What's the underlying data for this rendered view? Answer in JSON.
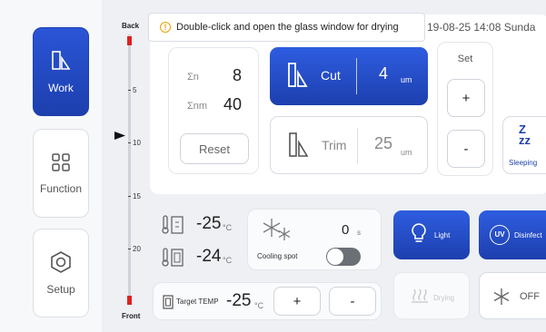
{
  "nav": {
    "work": "Work",
    "function": "Function",
    "setup": "Setup"
  },
  "ruler": {
    "top_label": "Back",
    "bottom_label": "Front",
    "ticks": [
      "5",
      "10",
      "15",
      "20"
    ]
  },
  "tooltip": {
    "text": "Double-click and open the glass window for drying"
  },
  "status": {
    "datetime": "19-08-25  14:08  Sunda"
  },
  "counters": {
    "sigma_n_label": "Σn",
    "sigma_n_value": "8",
    "sigma_nm_label": "Σnm",
    "sigma_nm_value": "40",
    "reset_label": "Reset"
  },
  "cut": {
    "label": "Cut",
    "value": "4",
    "unit": "um"
  },
  "trim": {
    "label": "Trim",
    "value": "25",
    "unit": "um"
  },
  "set": {
    "label": "Set",
    "plus": "+",
    "minus": "-"
  },
  "sleeping": {
    "label": "Sleeping"
  },
  "temps": {
    "temp1": "-25",
    "temp2": "-24",
    "unit": "°C"
  },
  "cooling": {
    "label": "Cooling spot",
    "value": "0",
    "unit": "s"
  },
  "target": {
    "label": "Target TEMP",
    "value": "-25",
    "unit": "°C",
    "plus": "+",
    "minus": "-"
  },
  "light": {
    "label": "Light"
  },
  "disinfect": {
    "label": "Disinfect"
  },
  "drying": {
    "label": "Drying"
  },
  "freeze": {
    "label": "OFF"
  },
  "colors": {
    "accent": "#1d3fae",
    "red": "#e02020",
    "bg": "#eef0f4"
  }
}
